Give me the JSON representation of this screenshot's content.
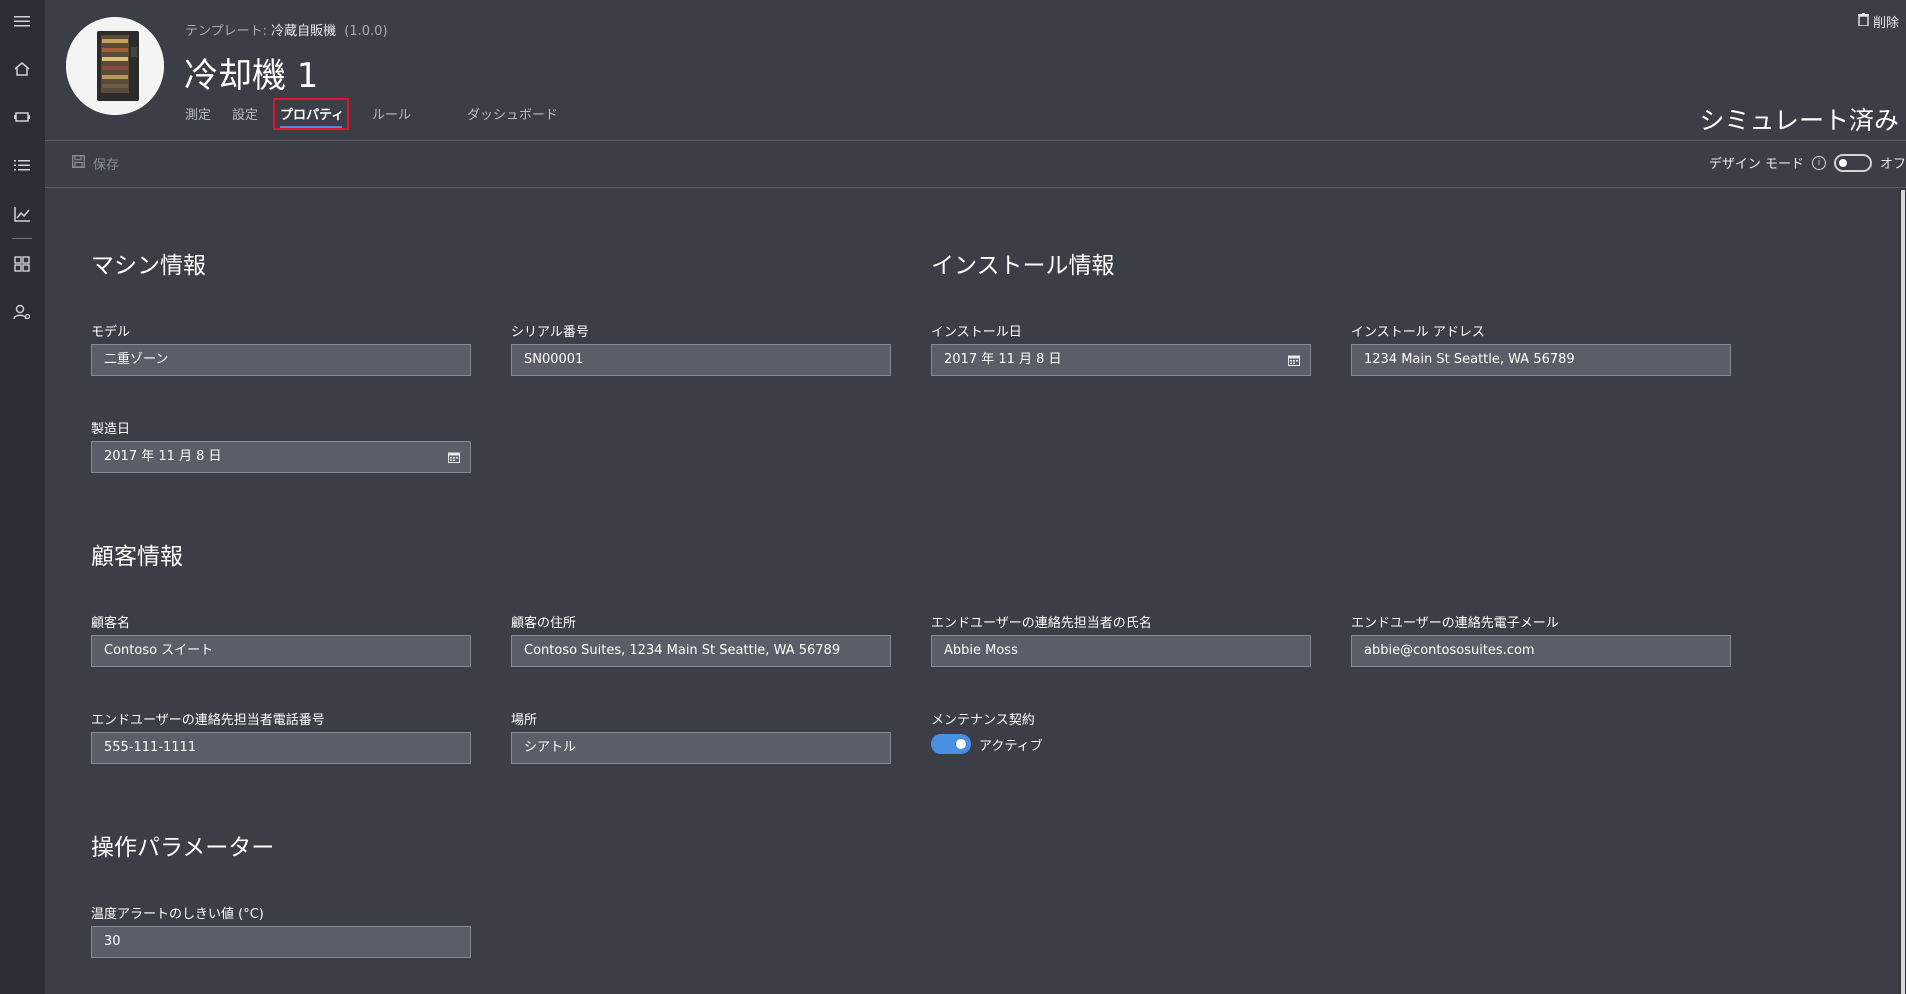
{
  "sidebar": {
    "icons": [
      "hamburger-menu-icon",
      "home-icon",
      "device-icon",
      "list-icon",
      "analytics-icon",
      "dashboard-grid-icon",
      "user-admin-icon"
    ]
  },
  "header": {
    "template_prefix": "テンプレート:",
    "template_name": "冷蔵自販機",
    "template_version": "(1.0.0)",
    "device_title": "冷却機 1",
    "tabs": [
      {
        "label": "測定"
      },
      {
        "label": "設定"
      },
      {
        "label": "プロパティ"
      },
      {
        "label": "ルール"
      },
      {
        "label": "ダッシュボード"
      }
    ],
    "active_tab": "プロパティ",
    "status": "シミュレート済み",
    "delete_label": "削除"
  },
  "toolbar": {
    "save_label": "保存",
    "design_mode_label": "デザイン モード",
    "design_mode_state": "オフ"
  },
  "sections": {
    "machine": {
      "title": "マシン情報",
      "model_label": "モデル",
      "model_value": "二重ゾーン",
      "serial_label": "シリアル番号",
      "serial_value": "SN00001",
      "mfg_date_label": "製造日",
      "mfg_date_value": "2017 年 11 月 8 日"
    },
    "install": {
      "title": "インストール情報",
      "date_label": "インストール日",
      "date_value": "2017 年 11 月 8 日",
      "address_label": "インストール アドレス",
      "address_value": "1234 Main St Seattle, WA 56789"
    },
    "customer": {
      "title": "顧客情報",
      "name_label": "顧客名",
      "name_value": "Contoso スイート",
      "address_label": "顧客の住所",
      "address_value": "Contoso Suites, 1234 Main St Seattle, WA 56789",
      "contact_name_label": "エンドユーザーの連絡先担当者の氏名",
      "contact_name_value": "Abbie Moss",
      "contact_email_label": "エンドユーザーの連絡先電子メール",
      "contact_email_value": "abbie@contososuites.com",
      "contact_phone_label": "エンドユーザーの連絡先担当者電話番号",
      "contact_phone_value": "555-111-1111",
      "location_label": "場所",
      "location_value": "シアトル",
      "maintenance_label": "メンテナンス契約",
      "maintenance_state": "アクティブ",
      "maintenance_active": true
    },
    "operation": {
      "title": "操作パラメーター",
      "temp_alert_label": "温度アラートのしきい値 (°C)",
      "temp_alert_value": "30"
    }
  },
  "colors": {
    "background": "#3b3e46",
    "sidebar": "#2c2e35",
    "accent": "#4a90e2",
    "highlight_box": "#e8112d",
    "input_bg": "#5a5e68"
  }
}
